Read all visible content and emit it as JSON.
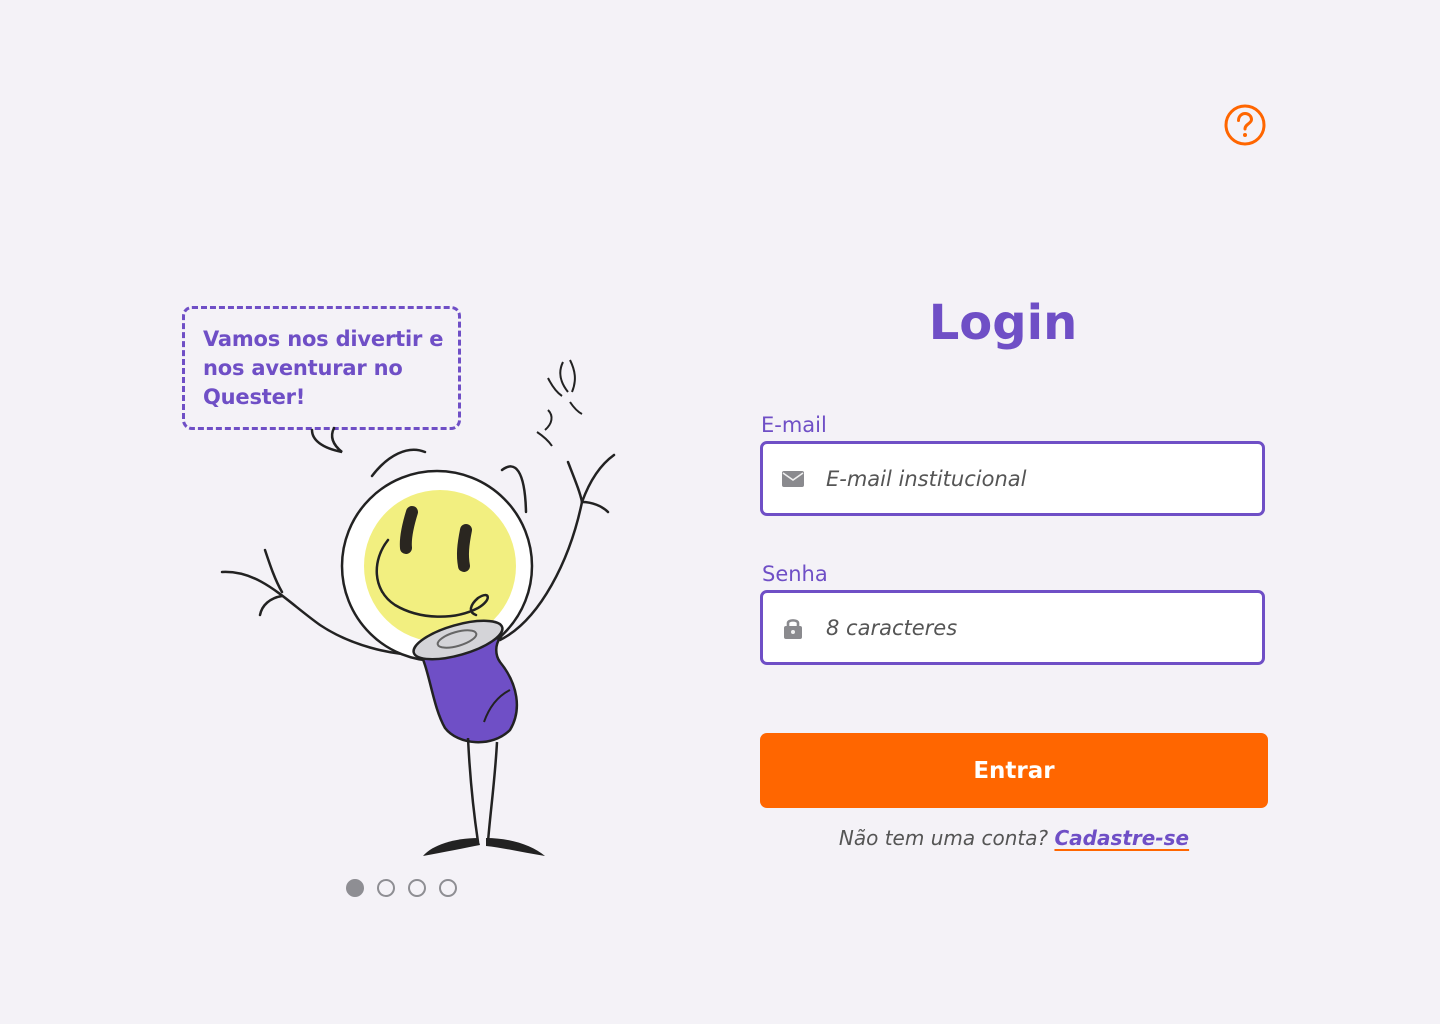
{
  "header": {
    "help_icon": "question-circle-icon",
    "accent_color": "#ff6600"
  },
  "carousel": {
    "bubble_text": "Vamos nos divertir e nos aventurar no Quester!",
    "pages": 4,
    "active_index": 0
  },
  "login": {
    "title": "Login",
    "email": {
      "label": "E-mail",
      "placeholder": "E-mail institucional",
      "icon": "envelope-icon"
    },
    "password": {
      "label": "Senha",
      "placeholder": "8 caracteres",
      "icon": "lock-icon"
    },
    "submit_label": "Entrar",
    "signup_prompt": "Não tem uma conta?",
    "signup_link": "Cadastre-se"
  },
  "colors": {
    "primary": "#6f4fc6",
    "accent": "#ff6600",
    "background": "#f4f2f7"
  }
}
